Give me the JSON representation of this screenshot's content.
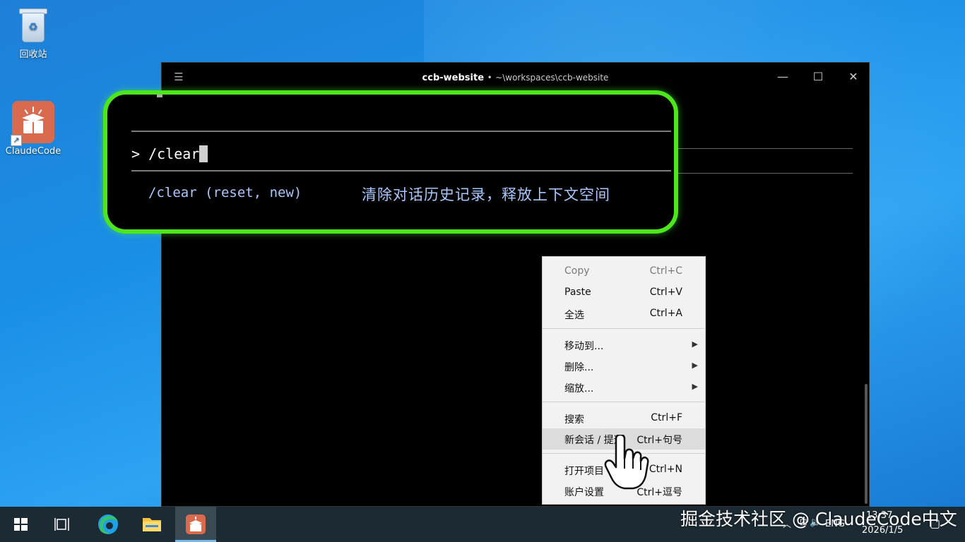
{
  "desktop": {
    "icons": [
      {
        "label": "回收站",
        "icon": "recycle-bin-icon"
      },
      {
        "label": "ClaudeCode",
        "icon": "claudecode-app-icon"
      }
    ]
  },
  "terminal": {
    "title": "ccb-website",
    "title_separator": "•",
    "path": "~\\workspaces\\ccb-website",
    "prompt": ">",
    "command": "/clear",
    "suggestion": {
      "command": "/clear (reset, new)",
      "description": "清除对话历史记录，释放上下文空间"
    }
  },
  "context_menu": {
    "groups": [
      [
        {
          "label": "Copy",
          "shortcut": "Ctrl+C",
          "disabled": true
        },
        {
          "label": "Paste",
          "shortcut": "Ctrl+V"
        },
        {
          "label": "全选",
          "shortcut": "Ctrl+A"
        }
      ],
      [
        {
          "label": "移动到...",
          "submenu": true
        },
        {
          "label": "删除...",
          "submenu": true
        },
        {
          "label": "缩放...",
          "submenu": true
        }
      ],
      [
        {
          "label": "搜索",
          "shortcut": "Ctrl+F"
        },
        {
          "label": "新会话 / 提速",
          "shortcut": "Ctrl+句号",
          "hover": true
        }
      ],
      [
        {
          "label": "打开项目",
          "shortcut": "Ctrl+N"
        },
        {
          "label": "账户设置",
          "shortcut": "Ctrl+逗号"
        }
      ]
    ]
  },
  "taskbar": {
    "tray": {
      "lang": "ENG",
      "date": "2026/1/5",
      "time": "13:37"
    }
  },
  "watermark": "掘金技术社区 @ ClaudeCode中文",
  "colors": {
    "highlight": "#4ce61a",
    "terminal_bg": "#000000",
    "suggestion_text": "#a7c7ff",
    "taskbar_bg": "#1c2a33"
  }
}
